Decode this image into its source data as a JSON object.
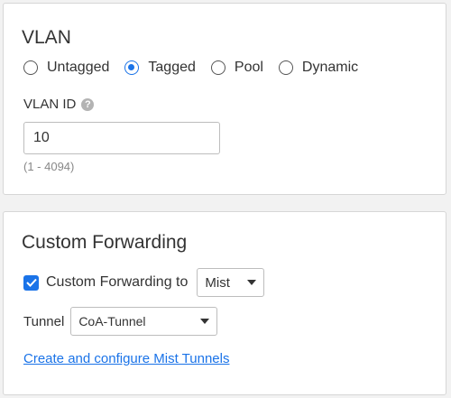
{
  "vlan": {
    "title": "VLAN",
    "radio_options": [
      {
        "label": "Untagged",
        "checked": false
      },
      {
        "label": "Tagged",
        "checked": true
      },
      {
        "label": "Pool",
        "checked": false
      },
      {
        "label": "Dynamic",
        "checked": false
      }
    ],
    "vlan_id_label": "VLAN ID",
    "vlan_id_value": "10",
    "vlan_id_hint": "(1 - 4094)",
    "help_icon_glyph": "?"
  },
  "custom_forwarding": {
    "title": "Custom Forwarding",
    "checkbox_checked": true,
    "checkbox_label": "Custom Forwarding to",
    "forward_to_value": "Mist",
    "tunnel_label": "Tunnel",
    "tunnel_value": "CoA-Tunnel",
    "link_text": "Create and configure Mist Tunnels"
  },
  "colors": {
    "accent": "#1a73e8",
    "card_border": "#d6d6d6",
    "hint": "#888888"
  }
}
